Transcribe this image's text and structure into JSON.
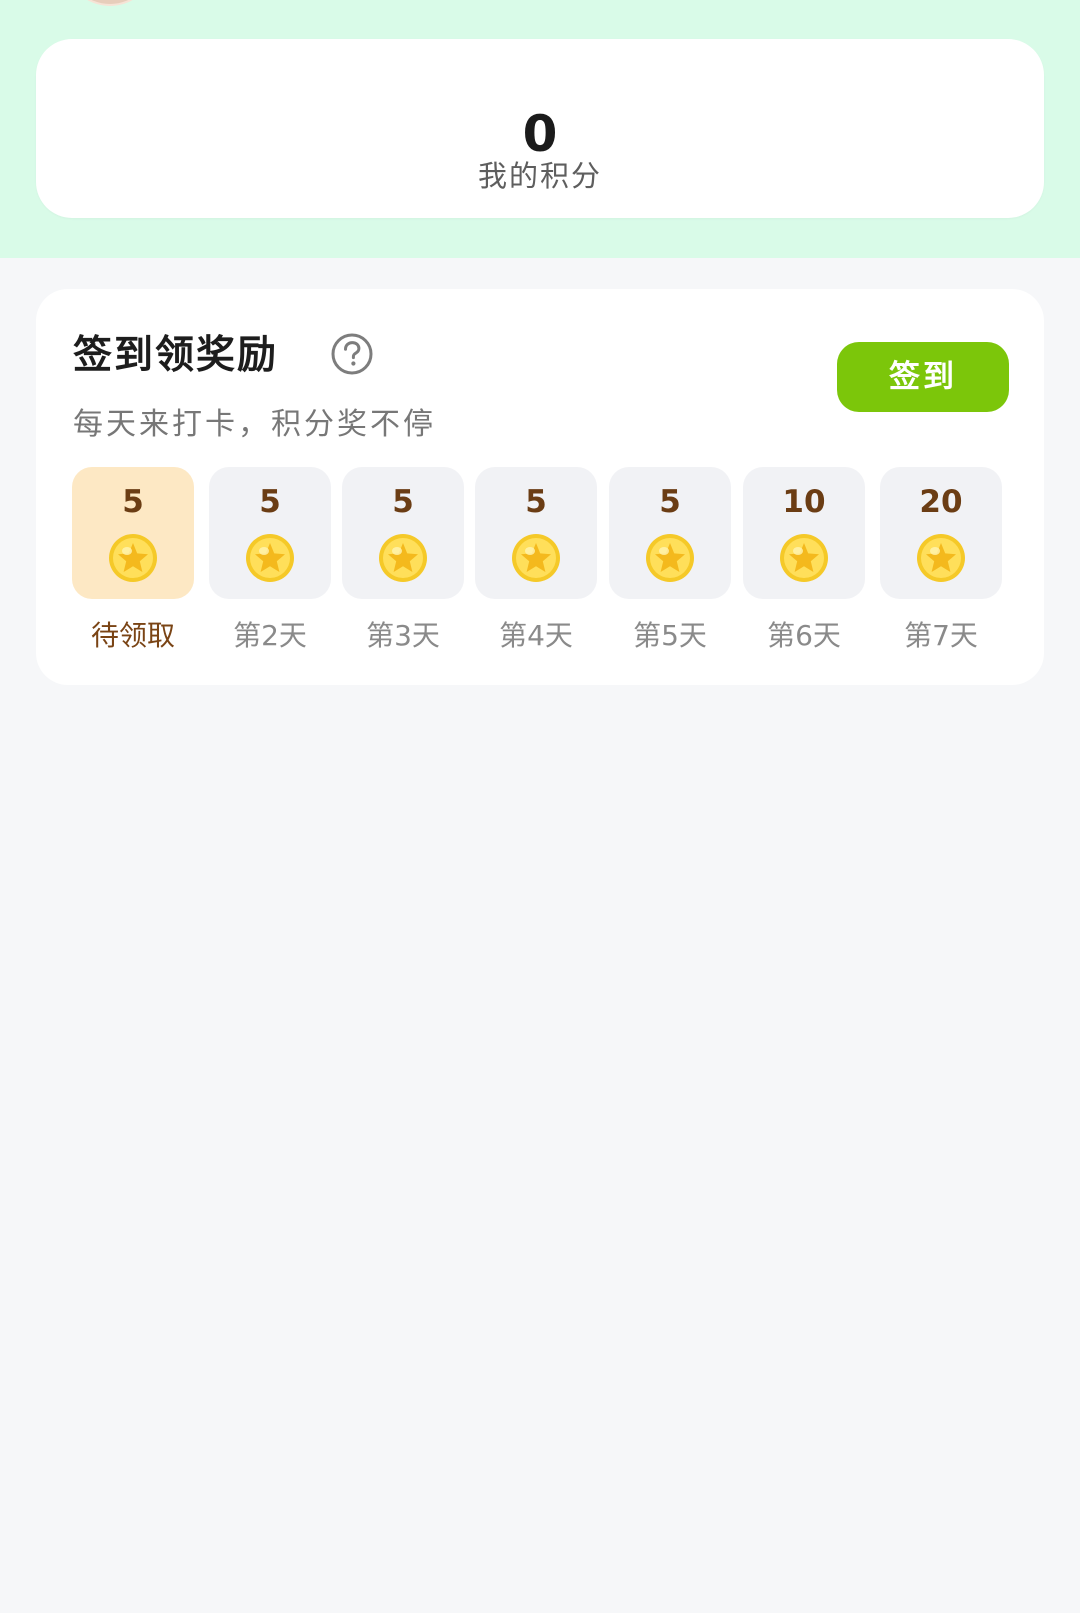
{
  "points": {
    "value": "0",
    "label": "我的积分"
  },
  "signin": {
    "title": "签到领奖励",
    "subtitle": "每天来打卡，积分奖不停",
    "button_label": "签到",
    "help_icon": "question-circle-icon",
    "days": [
      {
        "points": "5",
        "label": "待领取",
        "active": true
      },
      {
        "points": "5",
        "label": "第2天",
        "active": false
      },
      {
        "points": "5",
        "label": "第3天",
        "active": false
      },
      {
        "points": "5",
        "label": "第4天",
        "active": false
      },
      {
        "points": "5",
        "label": "第5天",
        "active": false
      },
      {
        "points": "10",
        "label": "第6天",
        "active": false
      },
      {
        "points": "20",
        "label": "第7天",
        "active": false
      }
    ]
  },
  "colors": {
    "top_background": "#d9fbe8",
    "page_background": "#f6f7f9",
    "button_green": "#7cc60a",
    "active_day_background": "#fde8c4",
    "inactive_day_background": "#f1f2f5",
    "reward_brown": "#6b3d14"
  }
}
